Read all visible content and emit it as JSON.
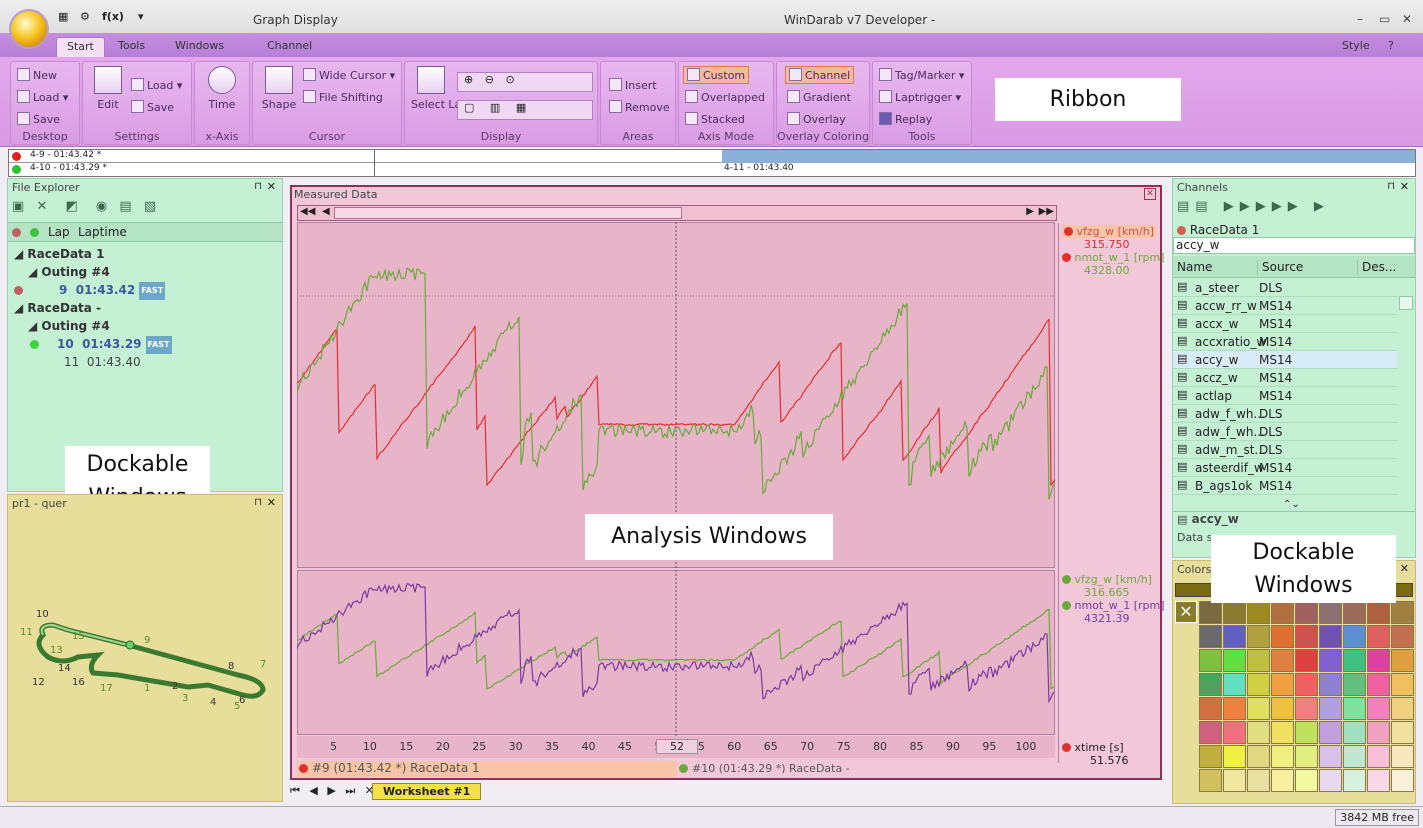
{
  "window": {
    "app_title": "Graph Display",
    "title": "WinDarab v7 Developer -",
    "qat_fx": "f(x)",
    "style_label": "Style"
  },
  "tabs": [
    "Start",
    "Tools",
    "Windows",
    "Channel"
  ],
  "ribbon": {
    "desktop": {
      "new": "New",
      "load": "Load",
      "save": "Save",
      "label": "Desktop"
    },
    "settings": {
      "edit": "Edit",
      "load": "Load",
      "save": "Save",
      "label": "Settings"
    },
    "xaxis": {
      "time": "Time",
      "label": "x-Axis"
    },
    "cursor": {
      "shape": "Shape",
      "wide_cursor": "Wide Cursor",
      "file_shifting": "File Shifting",
      "label": "Cursor"
    },
    "display": {
      "select_laps": "Select Laps",
      "label": "Display"
    },
    "areas": {
      "insert": "Insert",
      "remove": "Remove",
      "label": "Areas"
    },
    "axis_mode": {
      "custom": "Custom",
      "overlapped": "Overlapped",
      "stacked": "Stacked",
      "label": "Axis Mode"
    },
    "overlay_coloring": {
      "channel": "Channel",
      "gradient": "Gradient",
      "overlay": "Overlay",
      "label": "Overlay Coloring"
    },
    "tools": {
      "tag_marker": "Tag/Marker",
      "laptrigger": "Laptrigger",
      "replay": "Replay",
      "label": "Tools"
    }
  },
  "callouts": {
    "ribbon": "Ribbon",
    "dockable_left": "Dockable Windows",
    "analysis": "Analysis Windows",
    "dockable_right": "Dockable Windows"
  },
  "lapbar": {
    "lap1": "4-9 - 01:43.42 *",
    "lap2": "4-10 - 01:43.29 *",
    "lap3": "4-11 - 01:43.40"
  },
  "file_explorer": {
    "title": "File Explorer",
    "col_lap": "Lap",
    "col_laptime": "Laptime",
    "rows": [
      {
        "text": "RaceData 1"
      },
      {
        "text": "Outing #4"
      },
      {
        "lap": "9",
        "time": "01:43.42",
        "badge": "FAST"
      },
      {
        "text": "RaceData -"
      },
      {
        "text": "Outing #4"
      },
      {
        "lap": "10",
        "time": "01:43.29",
        "badge": "FAST"
      },
      {
        "lap": "11",
        "time": "01:43.40"
      }
    ]
  },
  "track": {
    "title": "pr1 - quer",
    "turns": [
      "10",
      "11",
      "9",
      "13",
      "15",
      "14",
      "12",
      "16",
      "17",
      "1",
      "2",
      "3",
      "4",
      "5",
      "6",
      "8",
      "7"
    ]
  },
  "analysis": {
    "title": "Measured Data",
    "plot1_legend": [
      {
        "name": "vfzg_w [km/h]",
        "value": "315.750",
        "color": "#e03030"
      },
      {
        "name": "nmot_w_1 [rpm]",
        "value": "4328.00",
        "color": "#6aaa3a"
      }
    ],
    "plot2_legend": [
      {
        "name": "vfzg_w [km/h]",
        "value": "316.665",
        "color": "#6aaa3a"
      },
      {
        "name": "nmot_w_1 [rpm]",
        "value": "4321.39",
        "color": "#6aaa3a"
      }
    ],
    "xaxis_legend": {
      "name": "xtime [s]",
      "value": "51.576"
    },
    "cursor_value": "52",
    "bottom_lap1": "#9 (01:43.42 *) RaceData 1",
    "bottom_lap2": "#10 (01:43.29 *) RaceData -",
    "worksheet_tab": "Worksheet #1"
  },
  "chart_data": {
    "type": "line",
    "x_ticks": [
      5,
      10,
      15,
      20,
      25,
      30,
      35,
      40,
      45,
      50,
      55,
      60,
      65,
      70,
      75,
      80,
      85,
      90,
      95,
      100
    ],
    "xlim": [
      0,
      104
    ],
    "xlabel": "xtime [s]"
  },
  "channels": {
    "title": "Channels",
    "source": "RaceData 1",
    "search": "accy_w",
    "cols": [
      "Name",
      "Source",
      "Des..."
    ],
    "rows": [
      {
        "name": "a_steer",
        "source": "DLS"
      },
      {
        "name": "accw_rr_w",
        "source": "MS14"
      },
      {
        "name": "accx_w",
        "source": "MS14"
      },
      {
        "name": "accxratio_w",
        "source": "MS14"
      },
      {
        "name": "accy_w",
        "source": "MS14"
      },
      {
        "name": "accz_w",
        "source": "MS14"
      },
      {
        "name": "actlap",
        "source": "MS14"
      },
      {
        "name": "adw_f_wh...",
        "source": "DLS"
      },
      {
        "name": "adw_f_wh...",
        "source": "DLS"
      },
      {
        "name": "adw_m_st...",
        "source": "DLS"
      },
      {
        "name": "asteerdif_w",
        "source": "MS14"
      },
      {
        "name": "B_ags1ok",
        "source": "MS14"
      }
    ],
    "detail_name": "accy_w",
    "detail_text": "Data so"
  },
  "colors_panel": {
    "title": "Colors"
  },
  "status": {
    "memory": "3842 MB free"
  }
}
